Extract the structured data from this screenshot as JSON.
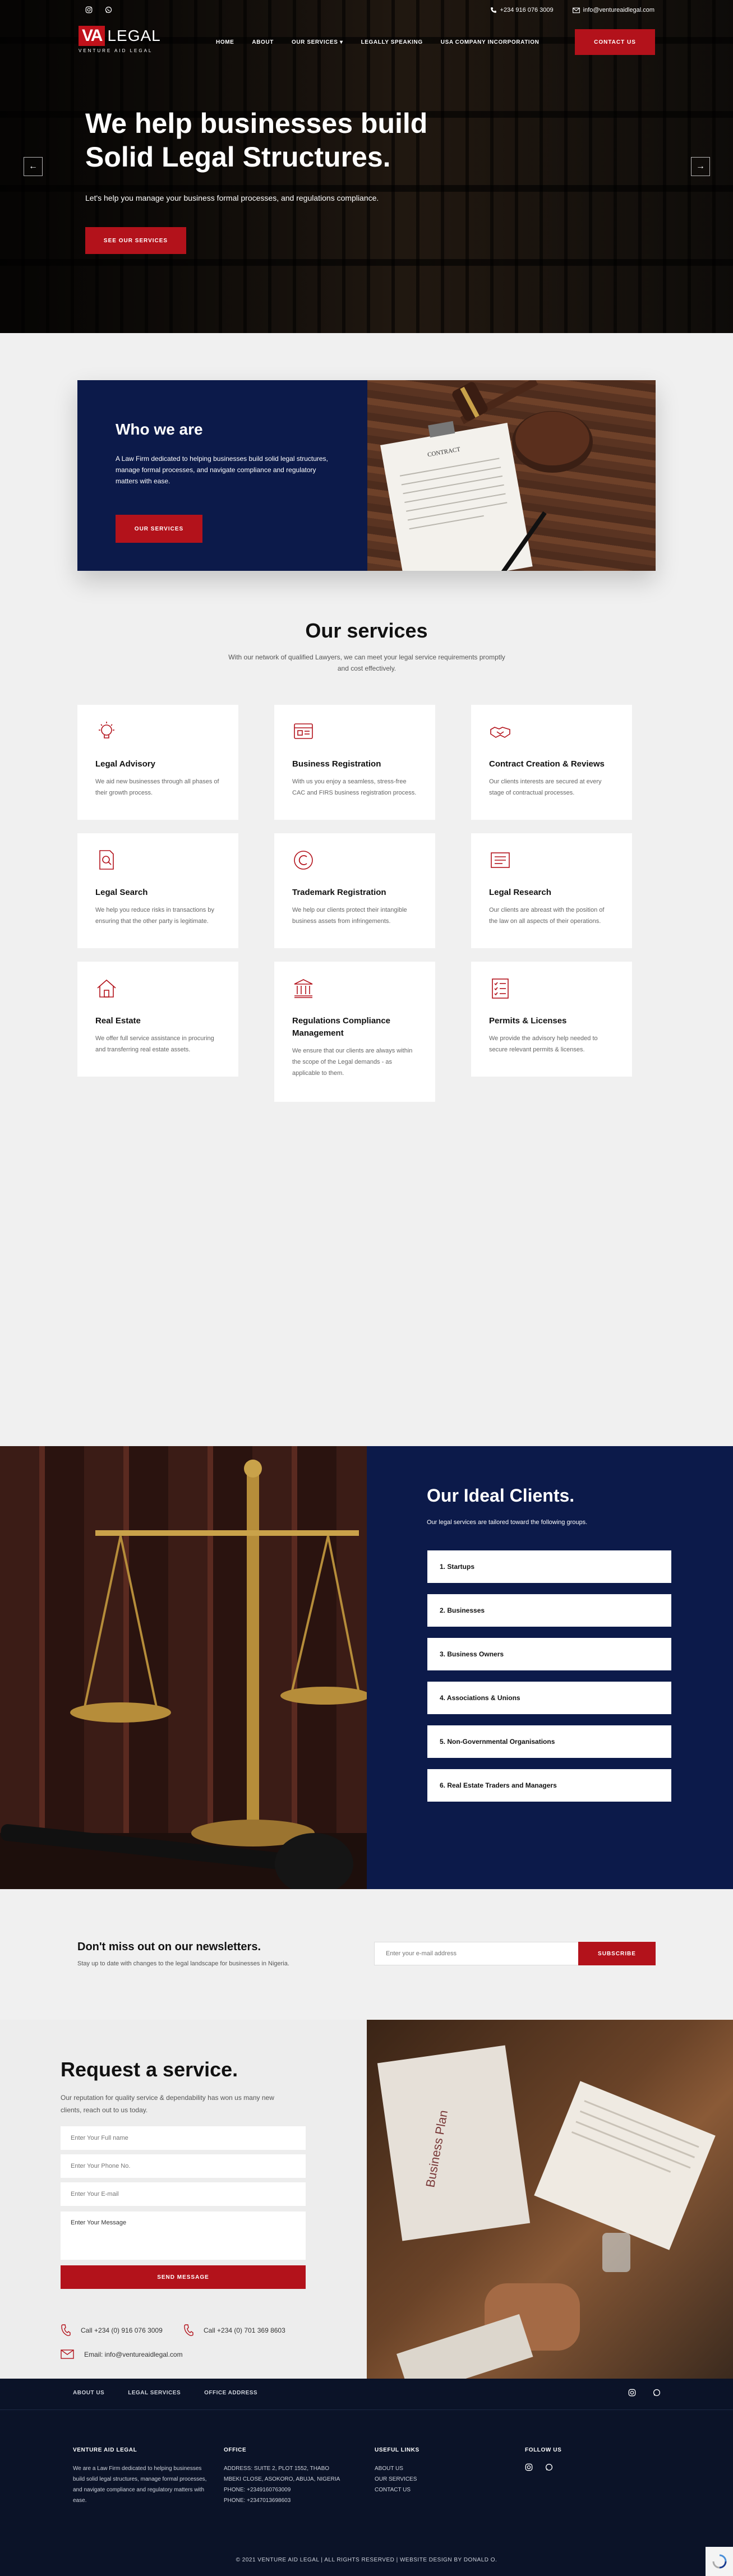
{
  "topbar": {
    "phone": "+234 916 076 3009",
    "email": "info@ventureaidlegal.com"
  },
  "logo": {
    "mark": "VA",
    "word": "LEGAL",
    "tagline": "VENTURE AID LEGAL"
  },
  "nav": {
    "items": [
      "HOME",
      "ABOUT",
      "OUR SERVICES ▾",
      "LEGALLY SPEAKING",
      "USA COMPANY INCORPORATION"
    ],
    "contact_label": "CONTACT US"
  },
  "hero": {
    "title": "We help businesses build Solid Legal Structures.",
    "lead": "Let's help you manage your business formal processes, and regulations compliance.",
    "cta": "SEE OUR SERVICES",
    "prev": "←",
    "next": "→"
  },
  "who": {
    "title": "Who we are",
    "text": "A Law Firm dedicated to helping businesses build solid legal structures, manage formal processes, and navigate compliance and regulatory matters with ease.",
    "cta": "OUR SERVICES",
    "contract_label": "CONTRACT"
  },
  "services": {
    "title": "Our services",
    "intro": "With our network of qualified Lawyers, we can meet your legal service requirements promptly and cost effectively.",
    "items": [
      {
        "icon": "lightbulb-icon",
        "title": "Legal Advisory",
        "text": "We aid new businesses through all phases of their growth process."
      },
      {
        "icon": "registration-icon",
        "title": "Business Registration",
        "text": "With us you enjoy a seamless, stress-free CAC and FIRS business registration process."
      },
      {
        "icon": "handshake-icon",
        "title": "Contract Creation & Reviews",
        "text": "Our clients interests are secured at every stage of contractual processes."
      },
      {
        "icon": "search-document-icon",
        "title": "Legal Search",
        "text": "We help you reduce risks in transactions by ensuring that the other party is legitimate."
      },
      {
        "icon": "copyright-icon",
        "title": "Trademark Registration",
        "text": "We help our clients protect their intangible business assets from infringements."
      },
      {
        "icon": "book-icon",
        "title": "Legal Research",
        "text": "Our clients are abreast with the position of the law on all aspects of their operations."
      },
      {
        "icon": "house-icon",
        "title": "Real Estate",
        "text": "We offer full service assistance in procuring and transferring real estate assets."
      },
      {
        "icon": "building-icon",
        "title": "Regulations Compliance Management",
        "text": "We ensure that our clients are always within the scope of the Legal demands - as applicable to them."
      },
      {
        "icon": "checklist-icon",
        "title": "Permits & Licenses",
        "text": "We provide the advisory help needed to secure relevant permits & licenses."
      }
    ]
  },
  "clients": {
    "title": "Our Ideal Clients.",
    "subtitle": "Our legal services are tailored toward the following groups.",
    "items": [
      "1. Startups",
      "2. Businesses",
      "3. Business Owners",
      "4. Associations & Unions",
      "5. Non-Governmental Organisations",
      "6. Real Estate Traders and Managers"
    ]
  },
  "newsletter": {
    "title": "Don't miss out on our newsletters.",
    "text": "Stay up to date with changes to the legal landscape for businesses in Nigeria.",
    "placeholder": "Enter your e-mail address",
    "button": "SUBSCRIBE"
  },
  "request": {
    "title": "Request a service.",
    "text": "Our reputation for quality service & dependability has won us many new clients, reach out to us today.",
    "fields": {
      "name": "Enter Your Full name",
      "phone": "Enter Your Phone No.",
      "email": "Enter Your E-mail",
      "message": "Enter Your Message"
    },
    "button": "SEND MESSAGE",
    "phone1": "Call +234 (0) 916 076 3009",
    "phone2": "Call +234 (0) 701 369 8603",
    "email": "Email: info@ventureaidlegal.com",
    "paper_label": "Business Plan"
  },
  "footer": {
    "nav": [
      "ABOUT US",
      "LEGAL SERVICES",
      "OFFICE ADDRESS"
    ],
    "about_title": "VENTURE AID LEGAL",
    "about_text": "We are a Law Firm dedicated to helping businesses build solid legal structures, manage formal processes, and navigate compliance and regulatory matters with ease.",
    "office_title": "OFFICE",
    "office_lines": [
      "ADDRESS: SUITE 2, PLOT 1552, THABO",
      "MBEKI CLOSE, ASOKORO, ABUJA, NIGERIA",
      "PHONE: +2349160763009",
      "PHONE: +2347013698603"
    ],
    "links_title": "USEFUL LINKS",
    "links": [
      "ABOUT US",
      "OUR SERVICES",
      "CONTACT US"
    ],
    "follow_title": "FOLLOW US",
    "copyright": "© 2021 VENTURE AID LEGAL | ALL RIGHTS RESERVED | WEBSITE DESIGN BY DONALD O."
  },
  "colors": {
    "accent": "#b3121b",
    "navy": "#0c1a4a",
    "footer": "#0b1328",
    "section_bg": "#f0f0f0"
  }
}
